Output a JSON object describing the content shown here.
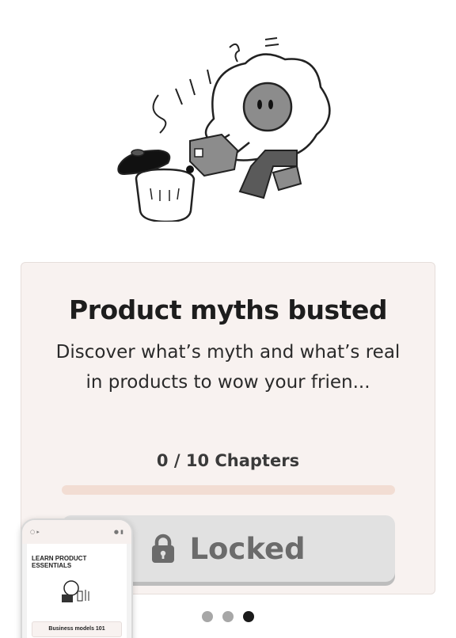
{
  "course_card": {
    "title": "Product myths busted",
    "description": "Discover what’s myth and what’s real in products to wow your frien...",
    "chapters_label": "0 / 10 Chapters",
    "progress_fraction": 0.0,
    "locked_label": "Locked"
  },
  "carousel": {
    "dot_count": 3,
    "active_index": 2
  },
  "phone_preview": {
    "header": "LEARN PRODUCT ESSENTIALS",
    "course_title": "Business models 101"
  },
  "icons": [
    "illustration-icon",
    "lock-icon"
  ],
  "colors": {
    "card_bg": "#f8f2f0",
    "progress_track": "#f2ddd3",
    "button_bg": "#e1e1e1",
    "button_text": "#6b6b6b",
    "dot_active": "#1a1a1a",
    "dot_inactive": "#a7a7a7"
  }
}
